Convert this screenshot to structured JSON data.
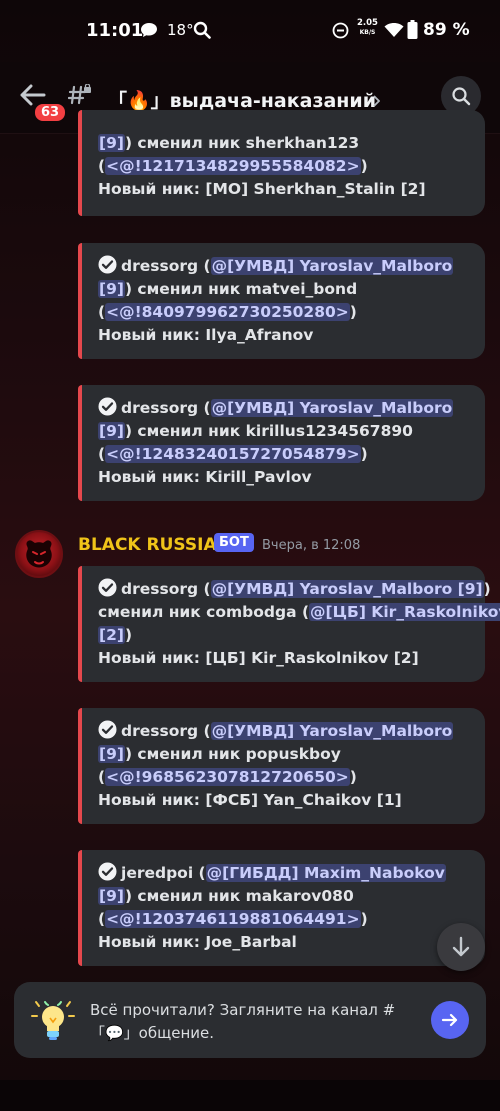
{
  "status_bar": {
    "time": "11:01",
    "temperature": "18°",
    "speed_value": "2.05",
    "speed_unit": "KB/S",
    "battery": "89 %"
  },
  "header": {
    "unread_count": "63",
    "channel_name": "「🔥」выдача-наказаний"
  },
  "message": {
    "author": "BLACK RUSSIA",
    "bot_tag": "БОТ",
    "timestamp": "Вчера, в 12:08"
  },
  "embeds": [
    {
      "l1a": "[9]",
      "l1b": ") сменил ник  sherkhan123",
      "l2a": "(",
      "l2b": "<@!1217134829955584082>",
      "l2c": ")",
      "l3": "Новый ник: [MO] Sherkhan_Stalin [2]"
    },
    {
      "user": "dressorg",
      "p1": " (",
      "m1": "@[УМВД] Yaroslav_Malboro",
      "m1b": "[9]",
      "t2": ") сменил ник  matvei_bond",
      "l3a": "(",
      "l3b": "<@!840979962730250280>",
      "l3c": ")",
      "l4": "Новый ник: Ilya_Afranov"
    },
    {
      "user": "dressorg",
      "p1": " (",
      "m1": "@[УМВД] Yaroslav_Malboro",
      "m1b": "[9]",
      "t2": ") сменил ник  kirillus1234567890",
      "l3a": "(",
      "l3b": "<@!1248324015727054879>",
      "l3c": ")",
      "l4": "Новый ник: Kirill_Pavlov"
    },
    {
      "user": "dressorg",
      "p1": " (",
      "m1": "@[УМВД] Yaroslav_Malboro [9]",
      "p1c": ")",
      "t2a": "сменил ник  combodga (",
      "m2": "@[ЦБ] Kir_Raskolnikov",
      "m2b": "[2]",
      "p2c": ")",
      "l4": "Новый ник: [ЦБ] Kir_Raskolnikov [2]"
    },
    {
      "user": "dressorg",
      "p1": " (",
      "m1": "@[УМВД] Yaroslav_Malboro",
      "m1b": "[9]",
      "t2": ") сменил ник  popuskboy",
      "l3a": "(",
      "l3b": "<@!968562307812720650>",
      "l3c": ")",
      "l4": "Новый ник: [ФСБ] Yan_Chaikov [1]"
    },
    {
      "user": "jeredpoi",
      "p1": " (",
      "m1": "@[ГИБДД] Maxim_Nabokov",
      "m1b": "[9]",
      "t2": ") сменил ник  makarov080",
      "l3a": "(",
      "l3b": "<@!1203746119881064491>",
      "l3c": ")",
      "l4": "Новый ник: Joe_Barbal"
    }
  ],
  "prompt": {
    "line1": "Всё прочитали? Загляните на канал #",
    "line2": "「💬」общение."
  },
  "colors": {
    "accent": "#5865f2",
    "embed_border": "#e5484d",
    "author": "#f0c419",
    "badge": "#f23f42"
  }
}
